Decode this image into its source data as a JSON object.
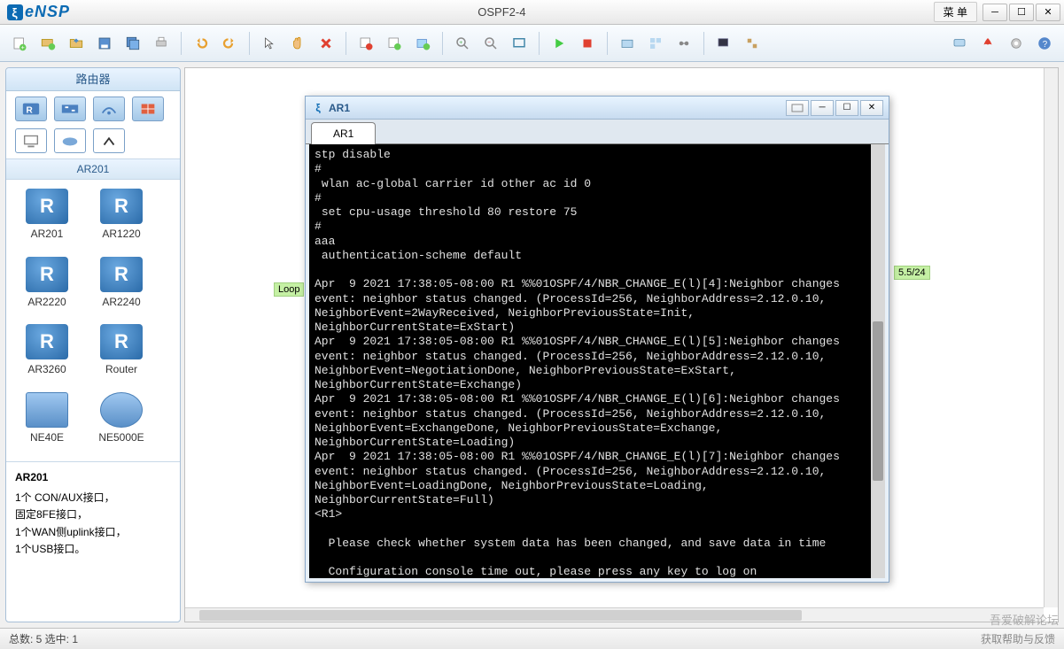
{
  "app": {
    "name": "eNSP",
    "title": "OSPF2-4",
    "menu_label": "菜 单"
  },
  "sidebar": {
    "header": "路由器",
    "category_header": "AR201",
    "devices": [
      {
        "label": "AR201"
      },
      {
        "label": "AR1220"
      },
      {
        "label": "AR2220"
      },
      {
        "label": "AR2240"
      },
      {
        "label": "AR3260"
      },
      {
        "label": "Router"
      },
      {
        "label": "NE40E"
      },
      {
        "label": "NE5000E"
      }
    ],
    "desc_title": "AR201",
    "desc_lines": [
      "1个 CON/AUX接口，",
      "固定8FE接口，",
      "1个WAN侧uplink接口，",
      "1个USB接口。"
    ]
  },
  "canvas": {
    "label_left": "Loop",
    "label_right": "5.5/24"
  },
  "terminal": {
    "win_title": "AR1",
    "tab_label": "AR1",
    "content": "stp disable\n#\n wlan ac-global carrier id other ac id 0\n#\n set cpu-usage threshold 80 restore 75\n#\naaa\n authentication-scheme default\n\nApr  9 2021 17:38:05-08:00 R1 %%01OSPF/4/NBR_CHANGE_E(l)[4]:Neighbor changes event: neighbor status changed. (ProcessId=256, NeighborAddress=2.12.0.10, NeighborEvent=2WayReceived, NeighborPreviousState=Init, NeighborCurrentState=ExStart)\nApr  9 2021 17:38:05-08:00 R1 %%01OSPF/4/NBR_CHANGE_E(l)[5]:Neighbor changes event: neighbor status changed. (ProcessId=256, NeighborAddress=2.12.0.10, NeighborEvent=NegotiationDone, NeighborPreviousState=ExStart, NeighborCurrentState=Exchange)\nApr  9 2021 17:38:05-08:00 R1 %%01OSPF/4/NBR_CHANGE_E(l)[6]:Neighbor changes event: neighbor status changed. (ProcessId=256, NeighborAddress=2.12.0.10, NeighborEvent=ExchangeDone, NeighborPreviousState=Exchange, NeighborCurrentState=Loading)\nApr  9 2021 17:38:05-08:00 R1 %%01OSPF/4/NBR_CHANGE_E(l)[7]:Neighbor changes event: neighbor status changed. (ProcessId=256, NeighborAddress=2.12.0.10, NeighborEvent=LoadingDone, NeighborPreviousState=Loading, NeighborCurrentState=Full)\n<R1>\n\n  Please check whether system data has been changed, and save data in time\n\n  Configuration console time out, please press any key to log on\n|"
  },
  "status": {
    "total": "总数: 5  选中: 1",
    "hint": "获取帮助与反馈"
  },
  "watermark": "吾爱破解论坛"
}
